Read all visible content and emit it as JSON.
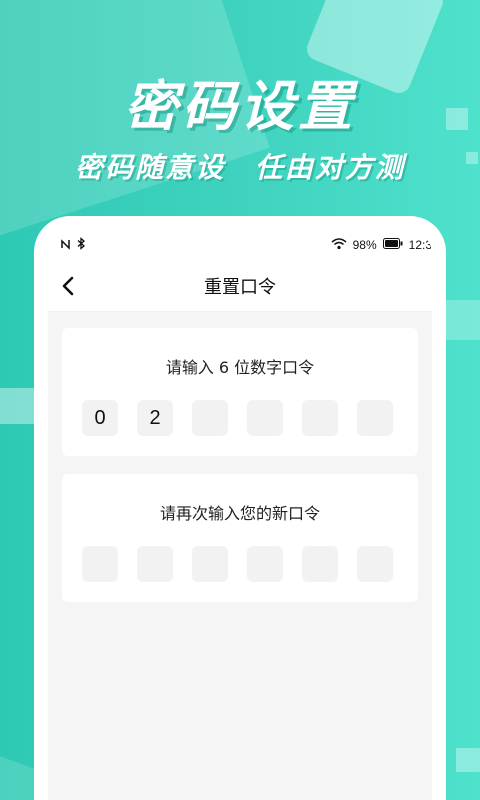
{
  "hero": {
    "title": "密码设置",
    "subtitle": "密码随意设  任由对方测"
  },
  "status_bar": {
    "left_icons": [
      "nfc-icon",
      "bluetooth-icon"
    ],
    "battery": "98%",
    "time": "12:3"
  },
  "navbar": {
    "title": "重置口令"
  },
  "first_entry": {
    "label": "请输入 6 位数字口令",
    "digits": [
      "0",
      "2",
      "",
      "",
      "",
      ""
    ]
  },
  "second_entry": {
    "label": "请再次输入您的新口令",
    "digits": [
      "",
      "",
      "",
      "",
      "",
      ""
    ]
  },
  "colors": {
    "background_teal": "#3fd3bf",
    "screen_bg": "#f5f5f6",
    "box_bg": "#f2f2f3"
  }
}
